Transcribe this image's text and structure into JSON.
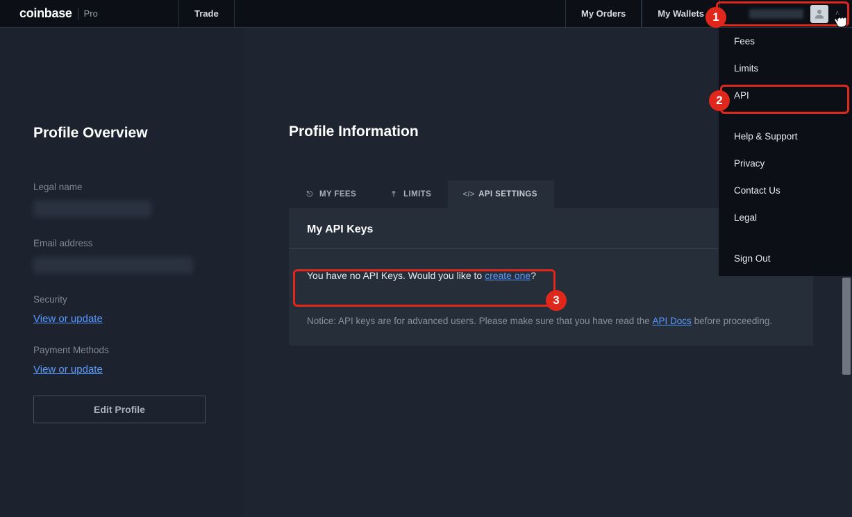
{
  "brand": {
    "main": "coinbase",
    "sub": "Pro"
  },
  "nav": {
    "trade": "Trade",
    "my_orders": "My Orders",
    "my_wallets": "My Wallets"
  },
  "dropdown": {
    "fees": "Fees",
    "limits": "Limits",
    "api": "API",
    "help": "Help & Support",
    "privacy": "Privacy",
    "contact": "Contact Us",
    "legal": "Legal",
    "signout": "Sign Out"
  },
  "sidebar": {
    "title": "Profile Overview",
    "legal_name_label": "Legal name",
    "email_label": "Email address",
    "security_label": "Security",
    "security_link": "View or update",
    "payment_label": "Payment Methods",
    "payment_link": "View or update",
    "edit_btn": "Edit Profile"
  },
  "main": {
    "title": "Profile Information",
    "tabs": {
      "fees": "MY FEES",
      "limits": "LIMITS",
      "api": "API SETTINGS"
    },
    "panel_title": "My API Keys",
    "empty_prefix": "You have no API Keys. Would you like to ",
    "empty_link": "create one",
    "empty_suffix": "?",
    "notice_prefix": "Notice: API keys are for advanced users. Please make sure that you have read the ",
    "notice_link": "API Docs",
    "notice_suffix": " before proceeding."
  },
  "annotations": {
    "n1": "1",
    "n2": "2",
    "n3": "3"
  }
}
